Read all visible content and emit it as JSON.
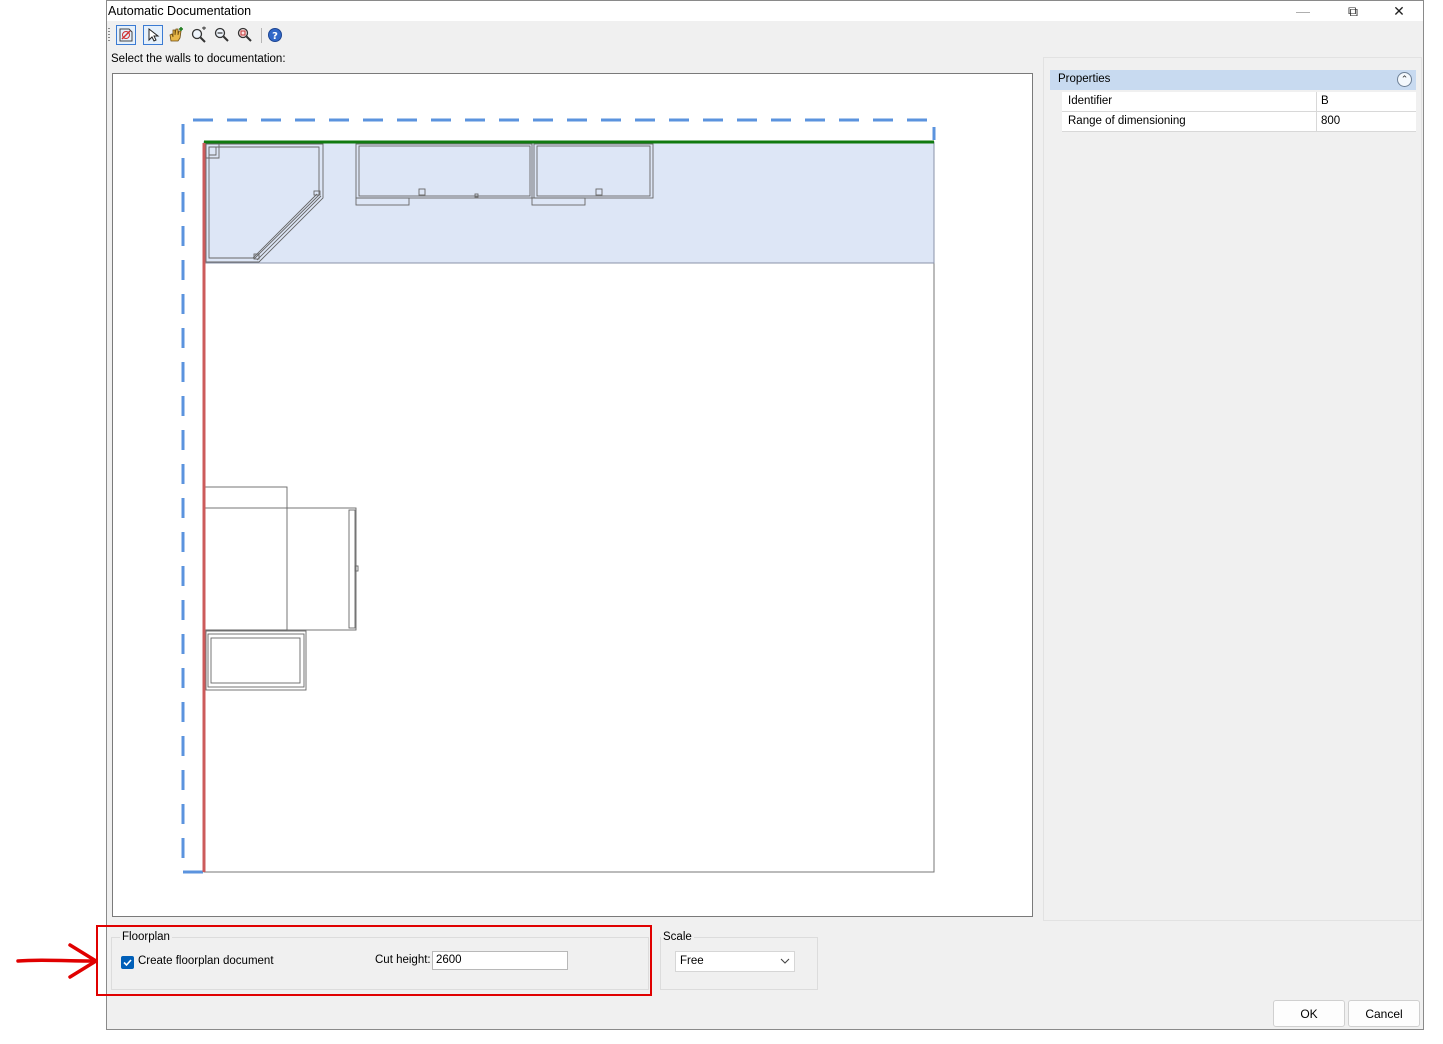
{
  "window": {
    "title": "Automatic Documentation",
    "controls": {
      "minimize": "—",
      "restore": "⧉",
      "close": "✕"
    }
  },
  "toolbar": {
    "items": [
      {
        "icon": "wall-select-icon",
        "active": true
      },
      {
        "icon": "pointer-icon",
        "active": true
      },
      {
        "icon": "pan-hand-icon",
        "active": false
      },
      {
        "icon": "zoom-extents-icon",
        "active": false
      },
      {
        "icon": "zoom-out-icon",
        "active": false
      },
      {
        "icon": "zoom-window-icon",
        "active": false
      },
      {
        "icon": "help-icon",
        "active": false
      }
    ]
  },
  "instruction": "Select the walls to documentation:",
  "properties": {
    "title": "Properties",
    "rows": [
      {
        "name": "Identifier",
        "value": "B"
      },
      {
        "name": "Range of dimensioning",
        "value": "800"
      }
    ]
  },
  "floorplan": {
    "group_label": "Floorplan",
    "checkbox_label": "Create floorplan document",
    "checkbox_checked": true,
    "cut_height_label": "Cut height:",
    "cut_height_value": "2600"
  },
  "scale": {
    "group_label": "Scale",
    "selected": "Free"
  },
  "buttons": {
    "ok": "OK",
    "cancel": "Cancel"
  },
  "colors": {
    "selection_dashed": "#5b93de",
    "selected_wall_top": "#107a10",
    "selected_wall_left": "#cc5b5b",
    "cabinet_zone": "#dde6f6",
    "annotation": "#e00000",
    "checkbox": "#005fb8",
    "properties_header": "#c8daf0"
  }
}
